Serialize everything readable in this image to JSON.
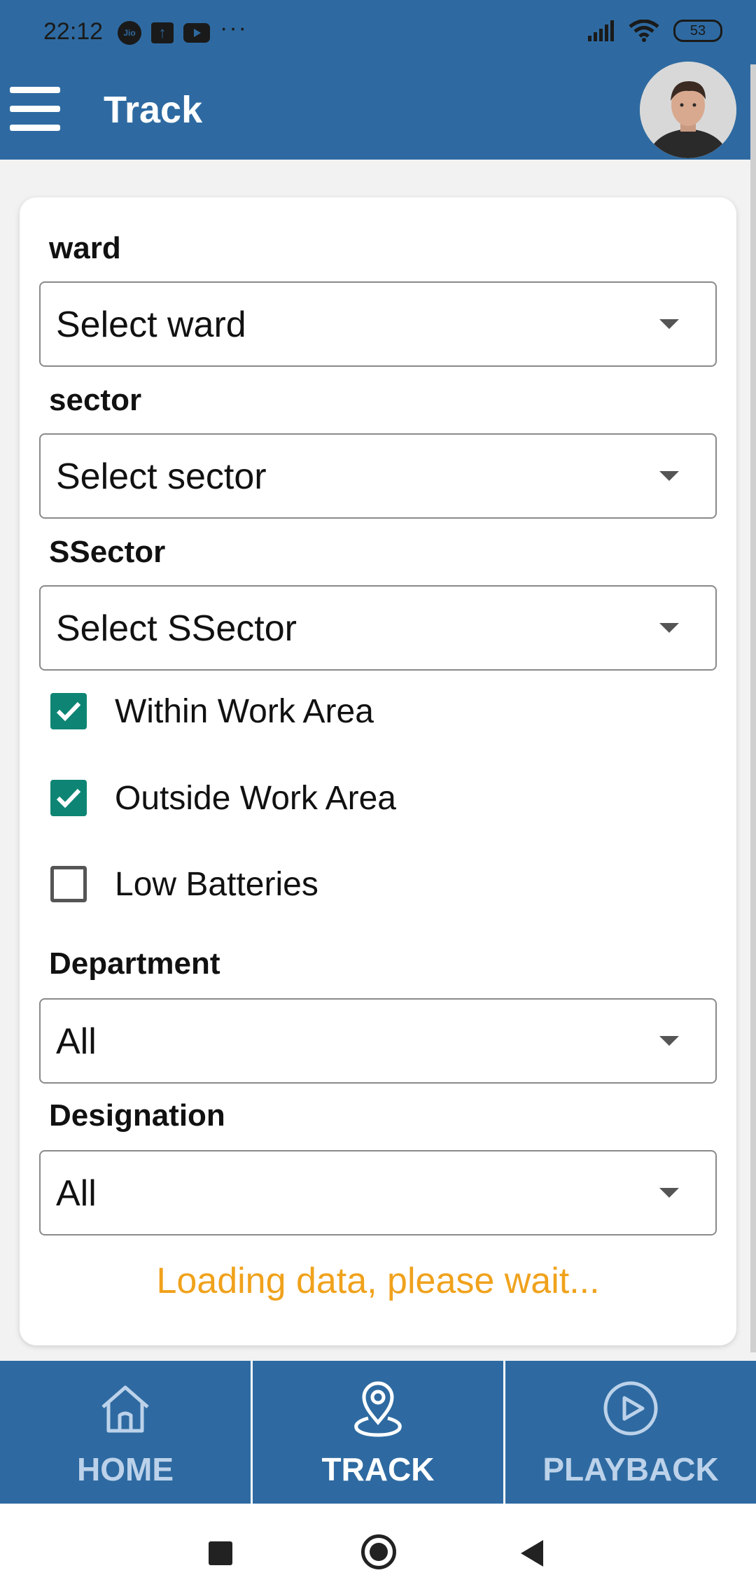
{
  "status_bar": {
    "time": "22:12",
    "left_icons": [
      "jio-icon",
      "upload-icon",
      "youtube-icon"
    ],
    "jio_text": "Jio",
    "more": "···",
    "battery": "53"
  },
  "header": {
    "title": "Track",
    "color": "#2e6aa1"
  },
  "form": {
    "ward": {
      "label": "ward",
      "value": "Select ward"
    },
    "sector": {
      "label": "sector",
      "value": "Select sector"
    },
    "ssector": {
      "label": "SSector",
      "value": "Select SSector"
    },
    "checkboxes": [
      {
        "label": "Within Work Area",
        "checked": true
      },
      {
        "label": "Outside Work Area",
        "checked": true
      },
      {
        "label": "Low Batteries",
        "checked": false
      }
    ],
    "department": {
      "label": "Department",
      "value": "All"
    },
    "designation": {
      "label": "Designation",
      "value": "All"
    },
    "loading_text": "Loading data, please wait...",
    "accent_color": "#0e8574",
    "loading_color": "#f0a21c"
  },
  "bottom_nav": {
    "tabs": [
      {
        "label": "HOME",
        "icon": "home-icon",
        "active": false
      },
      {
        "label": "TRACK",
        "icon": "location-pin-icon",
        "active": true
      },
      {
        "label": "PLAYBACK",
        "icon": "play-icon",
        "active": false
      }
    ]
  }
}
